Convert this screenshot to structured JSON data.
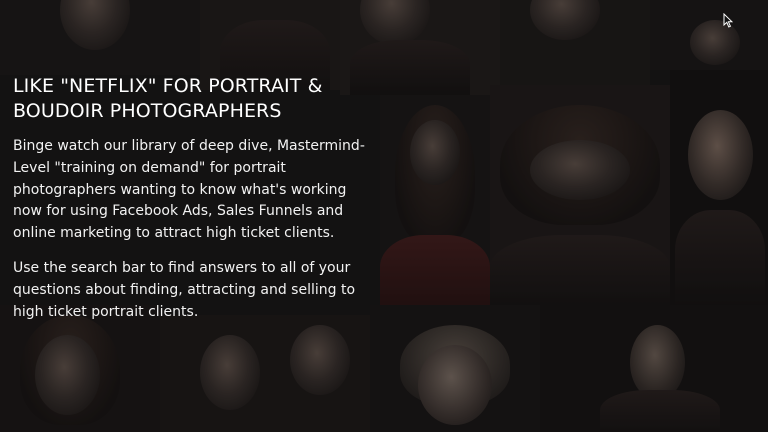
{
  "hero": {
    "headline": "LIKE \"NETFLIX\" FOR PORTRAIT & BOUDOIR PHOTOGRAPHERS",
    "paragraphs": [
      "Binge watch our library of deep dive, Mastermind-Level \"training on demand\" for portrait photographers wanting to know what's working now for using Facebook Ads, Sales Funnels and online marketing to attract high ticket clients.",
      "Use the search bar to find answers to all of your questions about finding, attracting and selling to high ticket portrait clients."
    ]
  },
  "background": {
    "description_icon": "portrait-collage",
    "base_color": "#1a1818"
  },
  "cursor": {
    "icon": "mouse-pointer-icon"
  }
}
